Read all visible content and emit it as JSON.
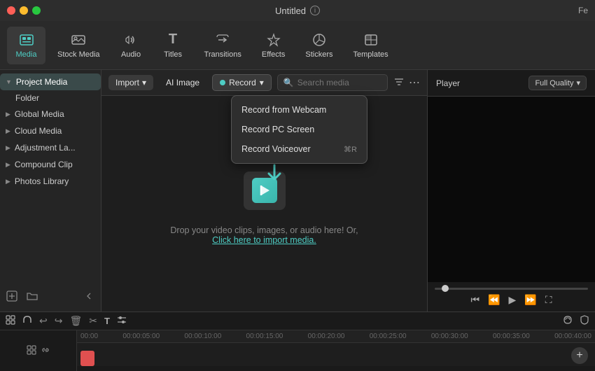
{
  "titleBar": {
    "title": "Untitled",
    "topRight": "Fe"
  },
  "toolbar": {
    "items": [
      {
        "id": "media",
        "label": "Media",
        "icon": "⊞",
        "active": true
      },
      {
        "id": "stock-media",
        "label": "Stock Media",
        "icon": "🎬"
      },
      {
        "id": "audio",
        "label": "Audio",
        "icon": "♪"
      },
      {
        "id": "titles",
        "label": "Titles",
        "icon": "T"
      },
      {
        "id": "transitions",
        "label": "Transitions",
        "icon": "↩"
      },
      {
        "id": "effects",
        "label": "Effects",
        "icon": "✦"
      },
      {
        "id": "stickers",
        "label": "Stickers",
        "icon": "◈"
      },
      {
        "id": "templates",
        "label": "Templates",
        "icon": "▭"
      }
    ]
  },
  "sidebar": {
    "sections": [
      {
        "id": "project-media",
        "label": "Project Media",
        "active": true,
        "subItems": [
          "Folder"
        ]
      },
      {
        "id": "global-media",
        "label": "Global Media",
        "active": false
      },
      {
        "id": "cloud-media",
        "label": "Cloud Media",
        "active": false
      },
      {
        "id": "adjustment-la",
        "label": "Adjustment La...",
        "active": false
      },
      {
        "id": "compound-clip",
        "label": "Compound Clip",
        "active": false
      },
      {
        "id": "photos-library",
        "label": "Photos Library",
        "active": false
      }
    ]
  },
  "mediaToolbar": {
    "importLabel": "Import",
    "aiImageLabel": "AI Image",
    "recordLabel": "Record",
    "searchPlaceholder": "Search media"
  },
  "dropdown": {
    "items": [
      {
        "id": "webcam",
        "label": "Record from Webcam",
        "shortcut": ""
      },
      {
        "id": "screen",
        "label": "Record PC Screen",
        "shortcut": ""
      },
      {
        "id": "voiceover",
        "label": "Record Voiceover",
        "shortcut": "⌘R"
      }
    ]
  },
  "mediaContent": {
    "dropText": "Drop your video clips, images, or audio here! Or,",
    "importLink": "Click here to import media."
  },
  "player": {
    "label": "Player",
    "quality": "Full Quality"
  },
  "timeline": {
    "rulerMarks": [
      "00:00",
      "00:00:05:00",
      "00:00:10:00",
      "00:00:15:00",
      "00:00:20:00",
      "00:00:25:00",
      "00:00:30:00",
      "00:00:35:00",
      "00:00:40:00"
    ]
  }
}
